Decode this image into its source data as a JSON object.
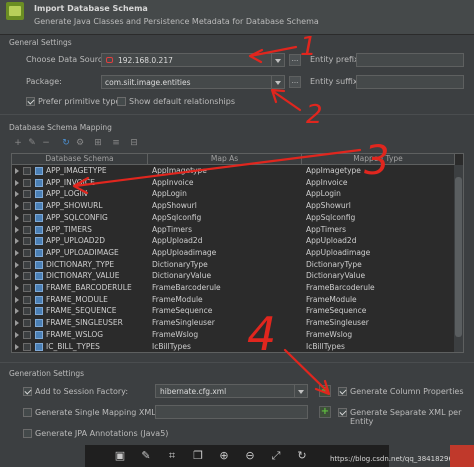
{
  "header": {
    "title": "Import Database Schema",
    "subtitle": "Generate Java Classes and Persistence Metadata for Database Schema"
  },
  "general": {
    "section_title": "General Settings",
    "choose_ds_label": "Choose Data Source:",
    "choose_ds_value": "192.168.0.217",
    "package_label": "Package:",
    "package_value": "com.siit.image.entities",
    "entity_prefix_label": "Entity prefix:",
    "entity_suffix_label": "Entity suffix:",
    "prefer_primitive_label": "Prefer primitive types",
    "show_default_rel_label": "Show default relationships",
    "dots": "..."
  },
  "mapping": {
    "section_title": "Database Schema Mapping",
    "columns": [
      "Database Schema",
      "Map As",
      "Mapped Type"
    ],
    "rows": [
      {
        "schema": "APP_IMAGETYPE",
        "map": "AppImagetype",
        "type": "AppImagetype"
      },
      {
        "schema": "APP_INVOICE",
        "map": "AppInvoice",
        "type": "AppInvoice"
      },
      {
        "schema": "APP_LOGIN",
        "map": "AppLogin",
        "type": "AppLogin"
      },
      {
        "schema": "APP_SHOWURL",
        "map": "AppShowurl",
        "type": "AppShowurl"
      },
      {
        "schema": "APP_SQLCONFIG",
        "map": "AppSqlconfig",
        "type": "AppSqlconfig"
      },
      {
        "schema": "APP_TIMERS",
        "map": "AppTimers",
        "type": "AppTimers"
      },
      {
        "schema": "APP_UPLOAD2D",
        "map": "AppUpload2d",
        "type": "AppUpload2d"
      },
      {
        "schema": "APP_UPLOADIMAGE",
        "map": "AppUploadimage",
        "type": "AppUploadimage"
      },
      {
        "schema": "DICTIONARY_TYPE",
        "map": "DictionaryType",
        "type": "DictionaryType"
      },
      {
        "schema": "DICTIONARY_VALUE",
        "map": "DictionaryValue",
        "type": "DictionaryValue"
      },
      {
        "schema": "FRAME_BARCODERULE",
        "map": "FrameBarcoderule",
        "type": "FrameBarcoderule"
      },
      {
        "schema": "FRAME_MODULE",
        "map": "FrameModule",
        "type": "FrameModule"
      },
      {
        "schema": "FRAME_SEQUENCE",
        "map": "FrameSequence",
        "type": "FrameSequence"
      },
      {
        "schema": "FRAME_SINGLEUSER",
        "map": "FrameSingleuser",
        "type": "FrameSingleuser"
      },
      {
        "schema": "FRAME_WSLOG",
        "map": "FrameWslog",
        "type": "FrameWslog"
      },
      {
        "schema": "IC_BILL_TYPES",
        "map": "IcBillTypes",
        "type": "IcBillTypes"
      }
    ]
  },
  "generation": {
    "section_title": "Generation Settings",
    "add_session_label": "Add to Session Factory:",
    "session_value": "hibernate.cfg.xml",
    "gen_single_label": "Generate Single Mapping XML:",
    "gen_jpa_label": "Generate JPA Annotations (Java5)",
    "gen_columns_label": "Generate Column Properties",
    "gen_separate_label": "Generate Separate XML per Entity",
    "plus": "+"
  },
  "annotations": {
    "n1": "1",
    "n2": "2",
    "n3": "3",
    "n4": "4"
  },
  "watermark": "https://blog.csdn.net/qq_38418296",
  "colors": {
    "annotation": "#e0261e",
    "background": "#3c3f41"
  }
}
